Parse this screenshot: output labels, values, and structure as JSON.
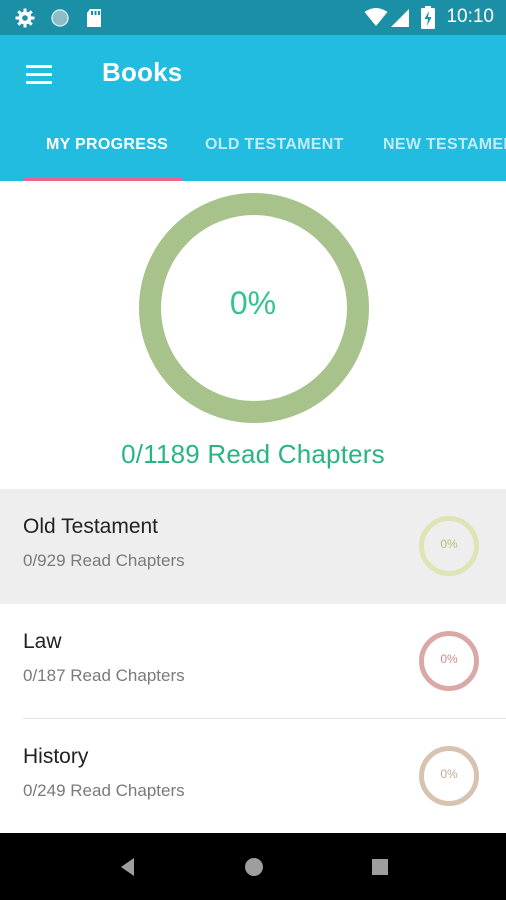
{
  "status_bar": {
    "time": "10:10",
    "background": "#1a8fa6"
  },
  "app_bar": {
    "title": "Books",
    "background": "#21bcdf"
  },
  "tabs": [
    {
      "label": "MY PROGRESS",
      "active": true
    },
    {
      "label": "OLD TESTAMENT",
      "active": false
    },
    {
      "label": "NEW TESTAMENT",
      "active": false
    }
  ],
  "overall": {
    "percent_label": "0%",
    "progress": 0,
    "read_chapters": "0/1189 Read Chapters",
    "ring_color": "#a8c28c",
    "text_color": "#33c48c"
  },
  "books": [
    {
      "title": "Old Testament",
      "read_chapters": "0/929 Read Chapters",
      "percent_label": "0%",
      "progress": 0,
      "ring_color": "#dfe4b4",
      "text_color": "#b7c07a",
      "highlighted": true
    },
    {
      "title": "Law",
      "read_chapters": "0/187 Read Chapters",
      "percent_label": "0%",
      "progress": 0,
      "ring_color": "#dba8a8",
      "text_color": "#d18c8c",
      "highlighted": false
    },
    {
      "title": "History",
      "read_chapters": "0/249 Read Chapters",
      "percent_label": "0%",
      "progress": 0,
      "ring_color": "#d6c4b0",
      "text_color": "#c2ab93",
      "highlighted": false
    }
  ],
  "icons": {
    "status_left": [
      "gear-icon",
      "circle-icon",
      "sd-card-icon"
    ],
    "status_right": [
      "wifi-icon",
      "signal-icon",
      "battery-charging-icon"
    ],
    "nav": [
      "back-icon",
      "home-icon",
      "recents-icon"
    ]
  }
}
